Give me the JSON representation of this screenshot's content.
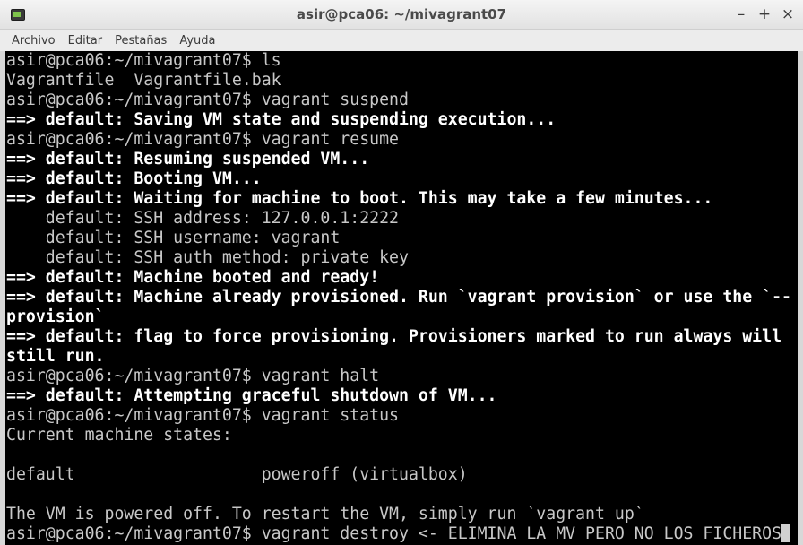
{
  "window": {
    "title": "asir@pca06: ~/mivagrant07",
    "controls": {
      "minimize": "–",
      "maximize": "+",
      "close": "×"
    }
  },
  "menu": {
    "items": [
      "Archivo",
      "Editar",
      "Pestañas",
      "Ayuda"
    ]
  },
  "terminal": {
    "lines": [
      {
        "text": "asir@pca06:~/mivagrant07$ ls",
        "bold": false
      },
      {
        "text": "Vagrantfile  Vagrantfile.bak",
        "bold": false
      },
      {
        "text": "asir@pca06:~/mivagrant07$ vagrant suspend",
        "bold": false
      },
      {
        "text": "==> default: Saving VM state and suspending execution...",
        "bold": true
      },
      {
        "text": "asir@pca06:~/mivagrant07$ vagrant resume",
        "bold": false
      },
      {
        "text": "==> default: Resuming suspended VM...",
        "bold": true
      },
      {
        "text": "==> default: Booting VM...",
        "bold": true
      },
      {
        "text": "==> default: Waiting for machine to boot. This may take a few minutes...",
        "bold": true
      },
      {
        "text": "    default: SSH address: 127.0.0.1:2222",
        "bold": false
      },
      {
        "text": "    default: SSH username: vagrant",
        "bold": false
      },
      {
        "text": "    default: SSH auth method: private key",
        "bold": false
      },
      {
        "text": "==> default: Machine booted and ready!",
        "bold": true
      },
      {
        "text": "==> default: Machine already provisioned. Run `vagrant provision` or use the `--",
        "bold": true
      },
      {
        "text": "provision`",
        "bold": true
      },
      {
        "text": "==> default: flag to force provisioning. Provisioners marked to run always will",
        "bold": true
      },
      {
        "text": "still run.",
        "bold": true
      },
      {
        "text": "asir@pca06:~/mivagrant07$ vagrant halt",
        "bold": false
      },
      {
        "text": "==> default: Attempting graceful shutdown of VM...",
        "bold": true
      },
      {
        "text": "asir@pca06:~/mivagrant07$ vagrant status",
        "bold": false
      },
      {
        "text": "Current machine states:",
        "bold": false
      },
      {
        "text": "",
        "bold": false
      },
      {
        "text": "default                   poweroff (virtualbox)",
        "bold": false
      },
      {
        "text": "",
        "bold": false
      },
      {
        "text": "The VM is powered off. To restart the VM, simply run `vagrant up`",
        "bold": false
      },
      {
        "text": "asir@pca06:~/mivagrant07$ vagrant destroy <- ELIMINA LA MV PERO NO LOS FICHEROS",
        "bold": false
      }
    ]
  }
}
